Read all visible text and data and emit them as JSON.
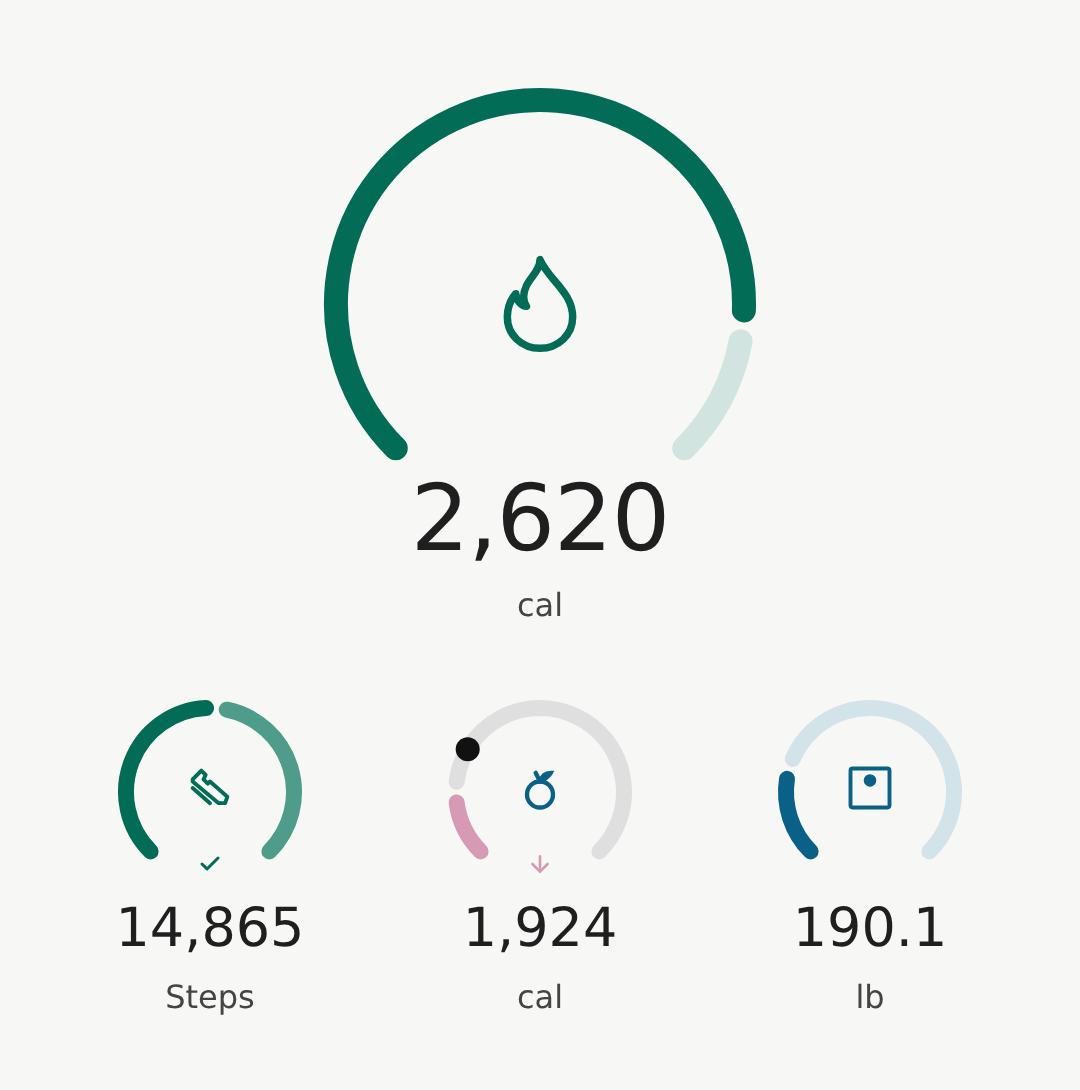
{
  "main": {
    "kind": "calories",
    "value": "2,620",
    "unit": "cal"
  },
  "metrics": [
    {
      "kind": "steps",
      "value": "14,865",
      "unit": "Steps"
    },
    {
      "kind": "food",
      "value": "1,924",
      "unit": "cal"
    },
    {
      "kind": "weight",
      "value": "190.1",
      "unit": "lb"
    }
  ]
}
